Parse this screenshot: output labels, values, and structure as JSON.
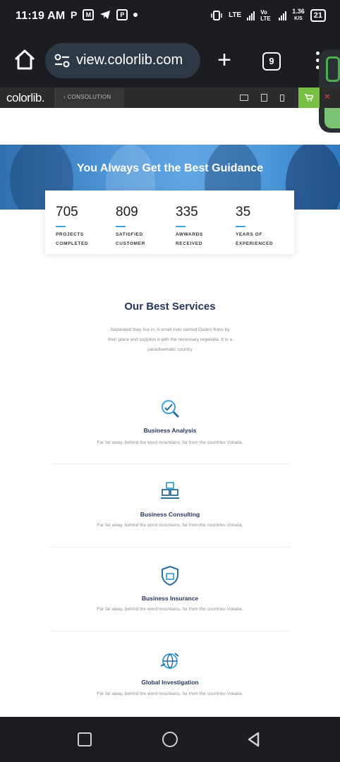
{
  "status_bar": {
    "time": "11:19 AM",
    "left_icons": [
      "P",
      "M",
      "telegram",
      "P",
      "dot"
    ],
    "network_a": "LTE",
    "network_b": "Vo LTE",
    "speed": "1.36",
    "speed_unit": "K/S",
    "battery": "21"
  },
  "browser": {
    "url": "view.colorlib.com",
    "tab_count": "9"
  },
  "demo_bar": {
    "logo": "colorlib.",
    "theme_name": "CONSOLUTION"
  },
  "hero": {
    "title": "You Always Get the Best Guidance"
  },
  "stats": [
    {
      "number": "705",
      "label_line1": "PROJECTS",
      "label_line2": "COMPLETED"
    },
    {
      "number": "809",
      "label_line1": "SATISFIED",
      "label_line2": "CUSTOMER"
    },
    {
      "number": "335",
      "label_line1": "AWWARDS",
      "label_line2": "RECEIVED"
    },
    {
      "number": "35",
      "label_line1": "YEARS OF",
      "label_line2": "EXPERIENCED"
    }
  ],
  "services": {
    "title": "Our Best Services",
    "description_lines": [
      "Separated they live in. A small river named Duden flows by",
      "their place and supplies it with the necessary regelialia. It is a",
      "paradisematic country"
    ],
    "items": [
      {
        "icon": "analysis-magnifier-icon",
        "name": "Business Analysis",
        "text": "Far far away, behind the word mountains, far from the countries Vokalia."
      },
      {
        "icon": "consulting-boxes-icon",
        "name": "Business Consulting",
        "text": "Far far away, behind the word mountains, far from the countries Vokalia."
      },
      {
        "icon": "insurance-shield-icon",
        "name": "Business Insurance",
        "text": "Far far away, behind the word mountains, far from the countries Vokalia."
      },
      {
        "icon": "investigation-globe-icon",
        "name": "Global Investigation",
        "text": "Far far away, behind the word mountains, far from the countries Vokalia."
      }
    ]
  },
  "colors": {
    "chrome_dark": "#1c1d22",
    "url_pill": "#2d3a45",
    "demo_bar": "#2b2b2b",
    "cart_green": "#77c043",
    "hero_blue": "#4b93d6",
    "accent_blue": "#3fa3dd",
    "heading_navy": "#24365a"
  }
}
